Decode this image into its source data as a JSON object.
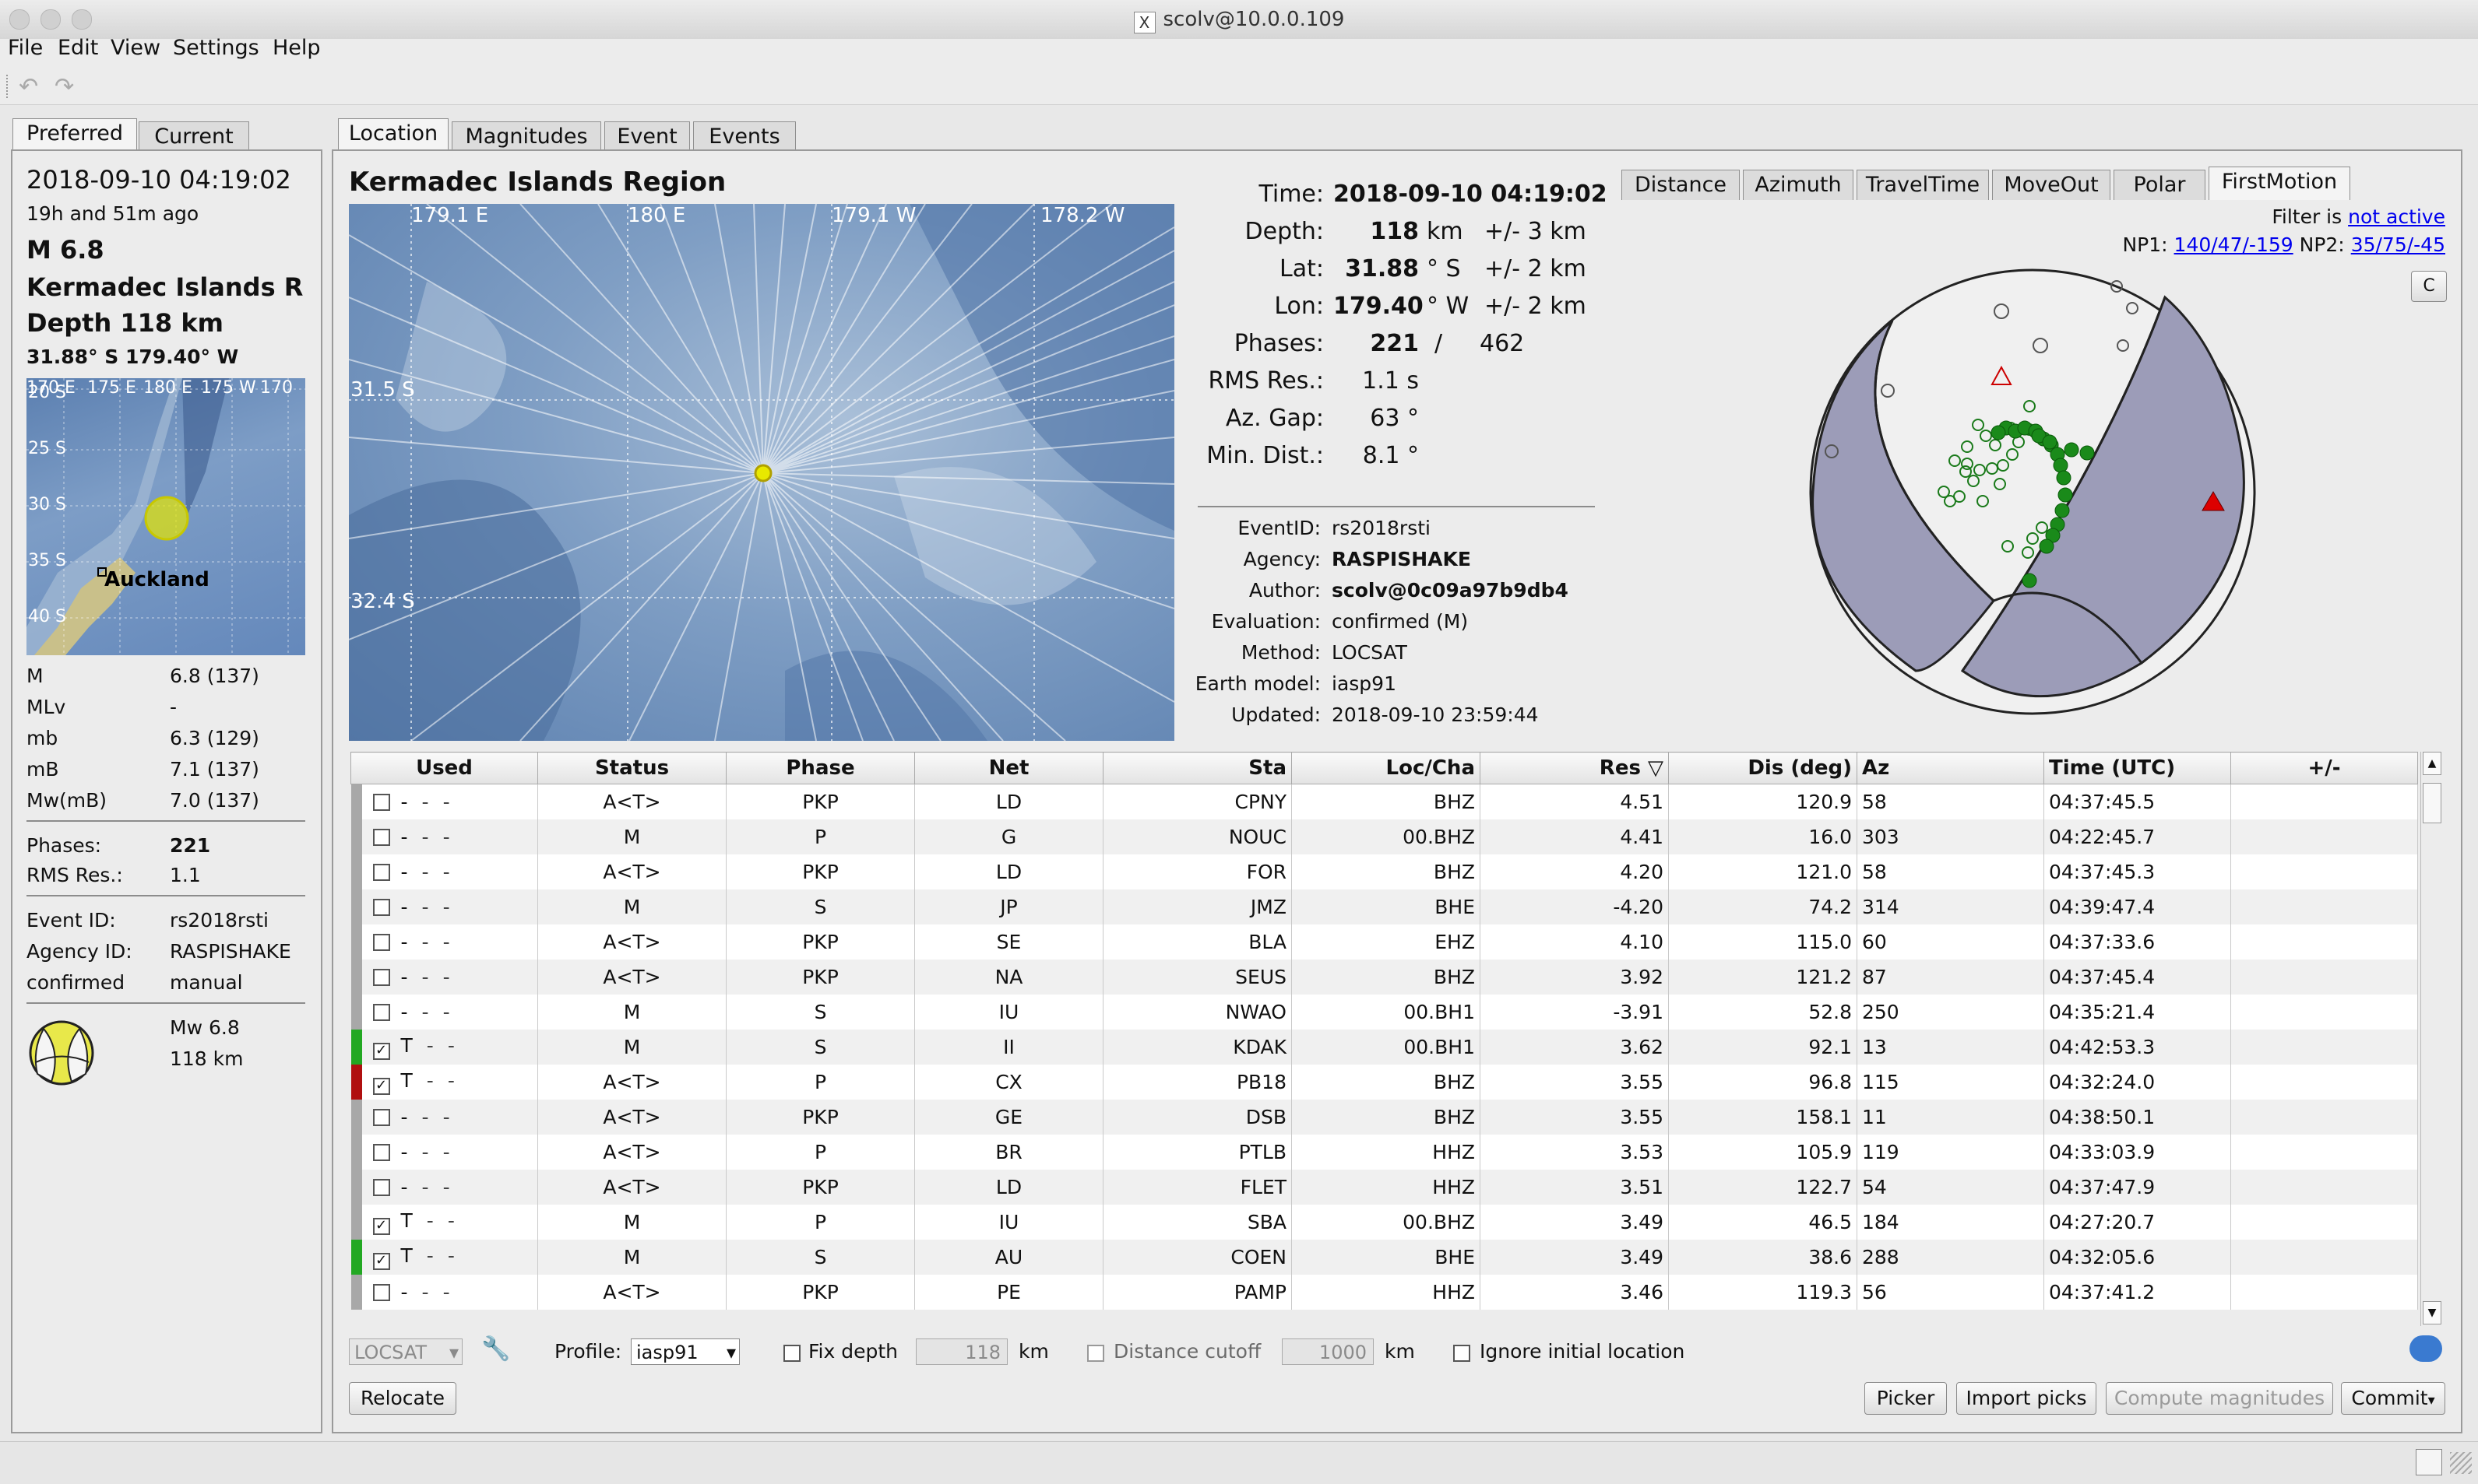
{
  "window": {
    "title": "scolv@10.0.0.109"
  },
  "menu": [
    "File",
    "Edit",
    "View",
    "Settings",
    "Help"
  ],
  "left_panel": {
    "tabs": [
      "Preferred",
      "Current"
    ],
    "datetime": "2018-09-10 04:19:02",
    "ago": "19h and 51m ago",
    "magnitude": "M 6.8",
    "region": "Kermadec Islands Re",
    "depth": "Depth 118 km",
    "coords": "31.88° S  179.40° W",
    "map": {
      "lon_labels": [
        "170 E",
        "175 E",
        "180 E",
        "175 W",
        "170"
      ],
      "lat_labels": [
        "20 S",
        "25 S",
        "30 S",
        "35 S",
        "40 S"
      ],
      "city": "Auckland"
    },
    "mags": [
      {
        "type": "M",
        "value": "6.8 (137)"
      },
      {
        "type": "MLv",
        "value": "-"
      },
      {
        "type": "mb",
        "value": "6.3 (129)"
      },
      {
        "type": "mB",
        "value": "7.1 (137)"
      },
      {
        "type": "Mw(mB)",
        "value": "7.0 (137)"
      }
    ],
    "phases_label": "Phases:",
    "phases_value": "221",
    "rms_label": "RMS Res.:",
    "rms_value": "1.1",
    "eventid_label": "Event ID:",
    "eventid_value": "rs2018rsti",
    "agency_label": "Agency ID:",
    "agency_value": "RASPISHAKE",
    "status_label": "confirmed",
    "status_value": "manual",
    "mw_line": "Mw 6.8",
    "depth_line": "118 km"
  },
  "tabs_main": [
    "Location",
    "Magnitudes",
    "Event",
    "Events"
  ],
  "region_title": "Kermadec Islands Region",
  "map_labels": {
    "lon": [
      "179.1 E",
      "180 E",
      "179.1 W",
      "178.2 W"
    ],
    "lat": [
      "31.5 S",
      "32.4 S"
    ]
  },
  "summary": {
    "time_label": "Time:",
    "time_value": "2018-09-10 04:19:02",
    "depth_label": "Depth:",
    "depth_value": "118",
    "depth_unit": "km",
    "depth_err": "+/- 3 km",
    "lat_label": "Lat:",
    "lat_value": "31.88",
    "lat_unit": "° S",
    "lat_err": "+/- 2 km",
    "lon_label": "Lon:",
    "lon_value": "179.40",
    "lon_unit": "° W",
    "lon_err": "+/- 2 km",
    "phases_label": "Phases:",
    "phases_used": "221",
    "phases_sep": "/",
    "phases_total": "462",
    "rms_label": "RMS Res.:",
    "rms_value": "1.1 s",
    "gap_label": "Az. Gap:",
    "gap_value": "63 °",
    "mindist_label": "Min. Dist.:",
    "mindist_value": "8.1 °"
  },
  "info": {
    "eventid_label": "EventID:",
    "eventid_value": "rs2018rsti",
    "agency_label": "Agency:",
    "agency_value": "RASPISHAKE",
    "author_label": "Author:",
    "author_value": "scolv@0c09a97b9db4",
    "eval_label": "Evaluation:",
    "eval_value": "confirmed (M)",
    "method_label": "Method:",
    "method_value": "LOCSAT",
    "model_label": "Earth model:",
    "model_value": "iasp91",
    "updated_label": "Updated:",
    "updated_value": "2018-09-10 23:59:44"
  },
  "plot_tabs": [
    "Distance",
    "Azimuth",
    "TravelTime",
    "MoveOut",
    "Polar",
    "FirstMotion"
  ],
  "filter": {
    "label": "Filter is",
    "value": "not active"
  },
  "np": {
    "np1_label": "NP1:",
    "np1_value": "140/47/-159",
    "np2_label": "NP2:",
    "np2_value": "35/75/-45"
  },
  "corner_button": "C",
  "table": {
    "headers": [
      "Used",
      "Status",
      "Phase",
      "Net",
      "Sta",
      "Loc/Cha",
      "Res",
      "Dis (deg)",
      "Az",
      "Time (UTC)",
      "+/-"
    ],
    "rows": [
      {
        "checked": false,
        "flag": "-",
        "status": "A<T>",
        "phase": "PKP",
        "net": "LD",
        "sta": "CPNY",
        "loc": "BHZ",
        "res": "4.51",
        "dis": "120.9",
        "az": "58",
        "time": "04:37:45.5",
        "bar": "#a8a8a8"
      },
      {
        "checked": false,
        "flag": "-",
        "status": "M",
        "phase": "P",
        "net": "G",
        "sta": "NOUC",
        "loc": "00.BHZ",
        "res": "4.41",
        "dis": "16.0",
        "az": "303",
        "time": "04:22:45.7",
        "bar": "#a8a8a8"
      },
      {
        "checked": false,
        "flag": "-",
        "status": "A<T>",
        "phase": "PKP",
        "net": "LD",
        "sta": "FOR",
        "loc": "BHZ",
        "res": "4.20",
        "dis": "121.0",
        "az": "58",
        "time": "04:37:45.3",
        "bar": "#a8a8a8"
      },
      {
        "checked": false,
        "flag": "-",
        "status": "M",
        "phase": "S",
        "net": "JP",
        "sta": "JMZ",
        "loc": "BHE",
        "res": "-4.20",
        "dis": "74.2",
        "az": "314",
        "time": "04:39:47.4",
        "bar": "#a8a8a8"
      },
      {
        "checked": false,
        "flag": "-",
        "status": "A<T>",
        "phase": "PKP",
        "net": "SE",
        "sta": "BLA",
        "loc": "EHZ",
        "res": "4.10",
        "dis": "115.0",
        "az": "60",
        "time": "04:37:33.6",
        "bar": "#a8a8a8"
      },
      {
        "checked": false,
        "flag": "-",
        "status": "A<T>",
        "phase": "PKP",
        "net": "NA",
        "sta": "SEUS",
        "loc": "BHZ",
        "res": "3.92",
        "dis": "121.2",
        "az": "87",
        "time": "04:37:45.4",
        "bar": "#a8a8a8"
      },
      {
        "checked": false,
        "flag": "-",
        "status": "M",
        "phase": "S",
        "net": "IU",
        "sta": "NWAO",
        "loc": "00.BH1",
        "res": "-3.91",
        "dis": "52.8",
        "az": "250",
        "time": "04:35:21.4",
        "bar": "#a8a8a8"
      },
      {
        "checked": true,
        "flag": "T",
        "status": "M",
        "phase": "S",
        "net": "II",
        "sta": "KDAK",
        "loc": "00.BH1",
        "res": "3.62",
        "dis": "92.1",
        "az": "13",
        "time": "04:42:53.3",
        "bar": "#22a822"
      },
      {
        "checked": true,
        "flag": "T",
        "status": "A<T>",
        "phase": "P",
        "net": "CX",
        "sta": "PB18",
        "loc": "BHZ",
        "res": "3.55",
        "dis": "96.8",
        "az": "115",
        "time": "04:32:24.0",
        "bar": "#b01010"
      },
      {
        "checked": false,
        "flag": "-",
        "status": "A<T>",
        "phase": "PKP",
        "net": "GE",
        "sta": "DSB",
        "loc": "BHZ",
        "res": "3.55",
        "dis": "158.1",
        "az": "11",
        "time": "04:38:50.1",
        "bar": "#a8a8a8"
      },
      {
        "checked": false,
        "flag": "-",
        "status": "A<T>",
        "phase": "P",
        "net": "BR",
        "sta": "PTLB",
        "loc": "HHZ",
        "res": "3.53",
        "dis": "105.9",
        "az": "119",
        "time": "04:33:03.9",
        "bar": "#a8a8a8"
      },
      {
        "checked": false,
        "flag": "-",
        "status": "A<T>",
        "phase": "PKP",
        "net": "LD",
        "sta": "FLET",
        "loc": "HHZ",
        "res": "3.51",
        "dis": "122.7",
        "az": "54",
        "time": "04:37:47.9",
        "bar": "#a8a8a8"
      },
      {
        "checked": true,
        "flag": "T",
        "status": "M",
        "phase": "P",
        "net": "IU",
        "sta": "SBA",
        "loc": "00.BHZ",
        "res": "3.49",
        "dis": "46.5",
        "az": "184",
        "time": "04:27:20.7",
        "bar": "#a8a8a8"
      },
      {
        "checked": true,
        "flag": "T",
        "status": "M",
        "phase": "S",
        "net": "AU",
        "sta": "COEN",
        "loc": "BHE",
        "res": "3.49",
        "dis": "38.6",
        "az": "288",
        "time": "04:32:05.6",
        "bar": "#22a822"
      },
      {
        "checked": false,
        "flag": "-",
        "status": "A<T>",
        "phase": "PKP",
        "net": "PE",
        "sta": "PAMP",
        "loc": "HHZ",
        "res": "3.46",
        "dis": "119.3",
        "az": "56",
        "time": "04:37:41.2",
        "bar": "#a8a8a8"
      }
    ]
  },
  "bottom": {
    "locator": "LOCSAT",
    "profile_label": "Profile:",
    "profile_value": "iasp91",
    "fixdepth_label": "Fix depth",
    "fixdepth_value": "118",
    "km1": "km",
    "cutoff_label": "Distance cutoff",
    "cutoff_value": "1000",
    "km2": "km",
    "ignore_label": "Ignore initial location",
    "relocate": "Relocate",
    "picker": "Picker",
    "import": "Import picks",
    "compute": "Compute magnitudes",
    "commit": "Commit"
  }
}
